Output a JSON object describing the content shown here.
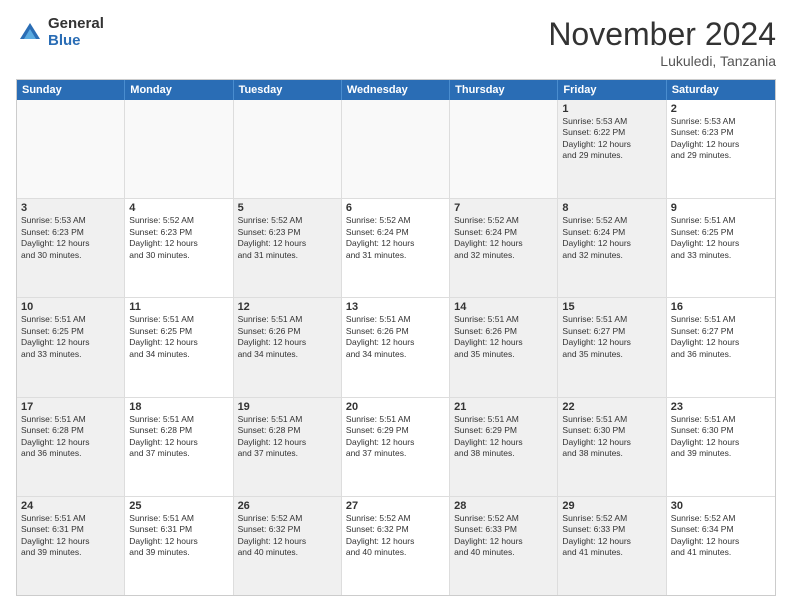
{
  "header": {
    "logo_general": "General",
    "logo_blue": "Blue",
    "month_year": "November 2024",
    "location": "Lukuledi, Tanzania"
  },
  "weekdays": [
    "Sunday",
    "Monday",
    "Tuesday",
    "Wednesday",
    "Thursday",
    "Friday",
    "Saturday"
  ],
  "weeks": [
    [
      {
        "day": "",
        "info": "",
        "empty": true
      },
      {
        "day": "",
        "info": "",
        "empty": true
      },
      {
        "day": "",
        "info": "",
        "empty": true
      },
      {
        "day": "",
        "info": "",
        "empty": true
      },
      {
        "day": "",
        "info": "",
        "empty": true
      },
      {
        "day": "1",
        "info": "Sunrise: 5:53 AM\nSunset: 6:22 PM\nDaylight: 12 hours\nand 29 minutes.",
        "shaded": true
      },
      {
        "day": "2",
        "info": "Sunrise: 5:53 AM\nSunset: 6:23 PM\nDaylight: 12 hours\nand 29 minutes."
      }
    ],
    [
      {
        "day": "3",
        "info": "Sunrise: 5:53 AM\nSunset: 6:23 PM\nDaylight: 12 hours\nand 30 minutes.",
        "shaded": true
      },
      {
        "day": "4",
        "info": "Sunrise: 5:52 AM\nSunset: 6:23 PM\nDaylight: 12 hours\nand 30 minutes."
      },
      {
        "day": "5",
        "info": "Sunrise: 5:52 AM\nSunset: 6:23 PM\nDaylight: 12 hours\nand 31 minutes.",
        "shaded": true
      },
      {
        "day": "6",
        "info": "Sunrise: 5:52 AM\nSunset: 6:24 PM\nDaylight: 12 hours\nand 31 minutes."
      },
      {
        "day": "7",
        "info": "Sunrise: 5:52 AM\nSunset: 6:24 PM\nDaylight: 12 hours\nand 32 minutes.",
        "shaded": true
      },
      {
        "day": "8",
        "info": "Sunrise: 5:52 AM\nSunset: 6:24 PM\nDaylight: 12 hours\nand 32 minutes.",
        "shaded": true
      },
      {
        "day": "9",
        "info": "Sunrise: 5:51 AM\nSunset: 6:25 PM\nDaylight: 12 hours\nand 33 minutes."
      }
    ],
    [
      {
        "day": "10",
        "info": "Sunrise: 5:51 AM\nSunset: 6:25 PM\nDaylight: 12 hours\nand 33 minutes.",
        "shaded": true
      },
      {
        "day": "11",
        "info": "Sunrise: 5:51 AM\nSunset: 6:25 PM\nDaylight: 12 hours\nand 34 minutes."
      },
      {
        "day": "12",
        "info": "Sunrise: 5:51 AM\nSunset: 6:26 PM\nDaylight: 12 hours\nand 34 minutes.",
        "shaded": true
      },
      {
        "day": "13",
        "info": "Sunrise: 5:51 AM\nSunset: 6:26 PM\nDaylight: 12 hours\nand 34 minutes."
      },
      {
        "day": "14",
        "info": "Sunrise: 5:51 AM\nSunset: 6:26 PM\nDaylight: 12 hours\nand 35 minutes.",
        "shaded": true
      },
      {
        "day": "15",
        "info": "Sunrise: 5:51 AM\nSunset: 6:27 PM\nDaylight: 12 hours\nand 35 minutes.",
        "shaded": true
      },
      {
        "day": "16",
        "info": "Sunrise: 5:51 AM\nSunset: 6:27 PM\nDaylight: 12 hours\nand 36 minutes."
      }
    ],
    [
      {
        "day": "17",
        "info": "Sunrise: 5:51 AM\nSunset: 6:28 PM\nDaylight: 12 hours\nand 36 minutes.",
        "shaded": true
      },
      {
        "day": "18",
        "info": "Sunrise: 5:51 AM\nSunset: 6:28 PM\nDaylight: 12 hours\nand 37 minutes."
      },
      {
        "day": "19",
        "info": "Sunrise: 5:51 AM\nSunset: 6:28 PM\nDaylight: 12 hours\nand 37 minutes.",
        "shaded": true
      },
      {
        "day": "20",
        "info": "Sunrise: 5:51 AM\nSunset: 6:29 PM\nDaylight: 12 hours\nand 37 minutes."
      },
      {
        "day": "21",
        "info": "Sunrise: 5:51 AM\nSunset: 6:29 PM\nDaylight: 12 hours\nand 38 minutes.",
        "shaded": true
      },
      {
        "day": "22",
        "info": "Sunrise: 5:51 AM\nSunset: 6:30 PM\nDaylight: 12 hours\nand 38 minutes.",
        "shaded": true
      },
      {
        "day": "23",
        "info": "Sunrise: 5:51 AM\nSunset: 6:30 PM\nDaylight: 12 hours\nand 39 minutes."
      }
    ],
    [
      {
        "day": "24",
        "info": "Sunrise: 5:51 AM\nSunset: 6:31 PM\nDaylight: 12 hours\nand 39 minutes.",
        "shaded": true
      },
      {
        "day": "25",
        "info": "Sunrise: 5:51 AM\nSunset: 6:31 PM\nDaylight: 12 hours\nand 39 minutes."
      },
      {
        "day": "26",
        "info": "Sunrise: 5:52 AM\nSunset: 6:32 PM\nDaylight: 12 hours\nand 40 minutes.",
        "shaded": true
      },
      {
        "day": "27",
        "info": "Sunrise: 5:52 AM\nSunset: 6:32 PM\nDaylight: 12 hours\nand 40 minutes."
      },
      {
        "day": "28",
        "info": "Sunrise: 5:52 AM\nSunset: 6:33 PM\nDaylight: 12 hours\nand 40 minutes.",
        "shaded": true
      },
      {
        "day": "29",
        "info": "Sunrise: 5:52 AM\nSunset: 6:33 PM\nDaylight: 12 hours\nand 41 minutes.",
        "shaded": true
      },
      {
        "day": "30",
        "info": "Sunrise: 5:52 AM\nSunset: 6:34 PM\nDaylight: 12 hours\nand 41 minutes."
      }
    ]
  ]
}
